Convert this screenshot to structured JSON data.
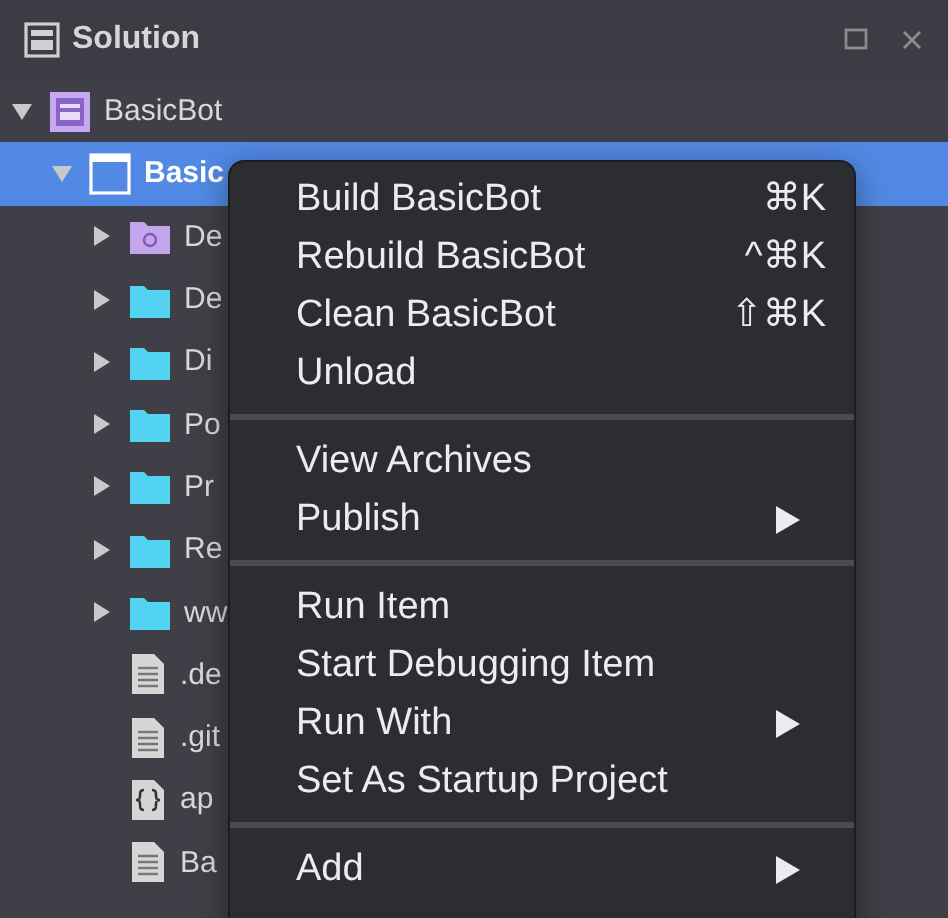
{
  "panel": {
    "title": "Solution"
  },
  "tree": [
    {
      "label": "BasicBot",
      "kind": "solution",
      "expanded": true,
      "selected": false,
      "children": [
        {
          "label": "Basic",
          "kind": "project",
          "expanded": true,
          "selected": true,
          "children": [
            {
              "label": "De",
              "kind": "references",
              "expanded": false,
              "selected": false
            },
            {
              "label": "De",
              "kind": "folder",
              "expanded": false,
              "selected": false
            },
            {
              "label": "Di",
              "kind": "folder",
              "expanded": false,
              "selected": false
            },
            {
              "label": "Po",
              "kind": "folder",
              "expanded": false,
              "selected": false
            },
            {
              "label": "Pr",
              "kind": "folder",
              "expanded": false,
              "selected": false
            },
            {
              "label": "Re",
              "kind": "folder",
              "expanded": false,
              "selected": false
            },
            {
              "label": "ww",
              "kind": "folder",
              "expanded": false,
              "selected": false
            },
            {
              "label": ".de",
              "kind": "file",
              "selected": false
            },
            {
              "label": ".git",
              "kind": "file",
              "selected": false
            },
            {
              "label": "ap",
              "kind": "json",
              "selected": false
            },
            {
              "label": "Ba",
              "kind": "file",
              "selected": false
            }
          ]
        }
      ]
    }
  ],
  "context_menu": {
    "groups": [
      [
        {
          "label": "Build BasicBot",
          "shortcut": "⌘K"
        },
        {
          "label": "Rebuild BasicBot",
          "shortcut": "^⌘K"
        },
        {
          "label": "Clean BasicBot",
          "shortcut": "⇧⌘K"
        },
        {
          "label": "Unload"
        }
      ],
      [
        {
          "label": "View Archives"
        },
        {
          "label": "Publish",
          "submenu": true
        }
      ],
      [
        {
          "label": "Run Item"
        },
        {
          "label": "Start Debugging Item"
        },
        {
          "label": "Run With",
          "submenu": true
        },
        {
          "label": "Set As Startup Project"
        }
      ],
      [
        {
          "label": "Add",
          "submenu": true
        }
      ]
    ]
  }
}
